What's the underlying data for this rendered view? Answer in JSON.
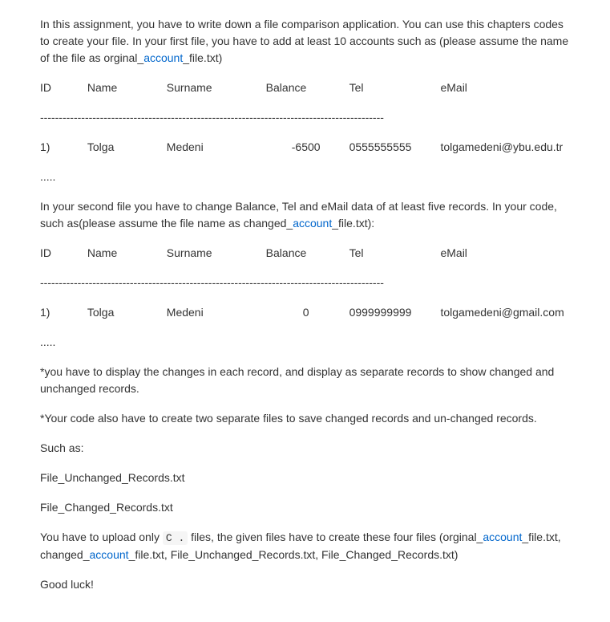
{
  "intro": {
    "part1": "In this assignment, you have to write down a file comparison application. You can use this chapters codes to create your file. In your first file, you have to add at least 10 accounts such as (please assume the name of the file as orginal_",
    "link1": "account",
    "part2": "_file.txt)"
  },
  "headers": {
    "id": "ID",
    "name": "Name",
    "surname": "Surname",
    "balance": "Balance",
    "tel": "Tel",
    "email": "eMail"
  },
  "divider": "--------------------------------------------------------------------------------------------",
  "record1": {
    "id": "1)",
    "name": "Tolga",
    "surname": "Medeni",
    "balance": "-6500",
    "tel": "0555555555",
    "email": "tolgamedeni@ybu.edu.tr"
  },
  "ellipsis": ".....",
  "second_intro": {
    "part1": "In your second file you have to change Balance, Tel and eMail data of at least five records. In your code, such as(please assume the file name as changed_",
    "link1": "account",
    "part2": "_file.txt):"
  },
  "record2": {
    "id": "1)",
    "name": "Tolga",
    "surname": "Medeni",
    "balance": "0",
    "tel": "0999999999",
    "email": "tolgamedeni@gmail.com"
  },
  "note1": "*you have to display the changes in each record, and display as separate records to show changed and unchanged records.",
  "note2": "*Your code also have to create two separate files to save changed records and un-changed records.",
  "such_as": "Such as:",
  "file_unchanged": "File_Unchanged_Records.txt",
  "file_changed": "File_Changed_Records.txt",
  "upload": {
    "part1": "You have to upload only ",
    "code": "C .",
    "part2": " files, the given files have to create these four files (orginal_",
    "link1": "account",
    "part3": "_file.txt, changed_",
    "link2": "account",
    "part4": "_file.txt, File_Unchanged_Records.txt, File_Changed_Records.txt)"
  },
  "goodluck": "Good luck!"
}
